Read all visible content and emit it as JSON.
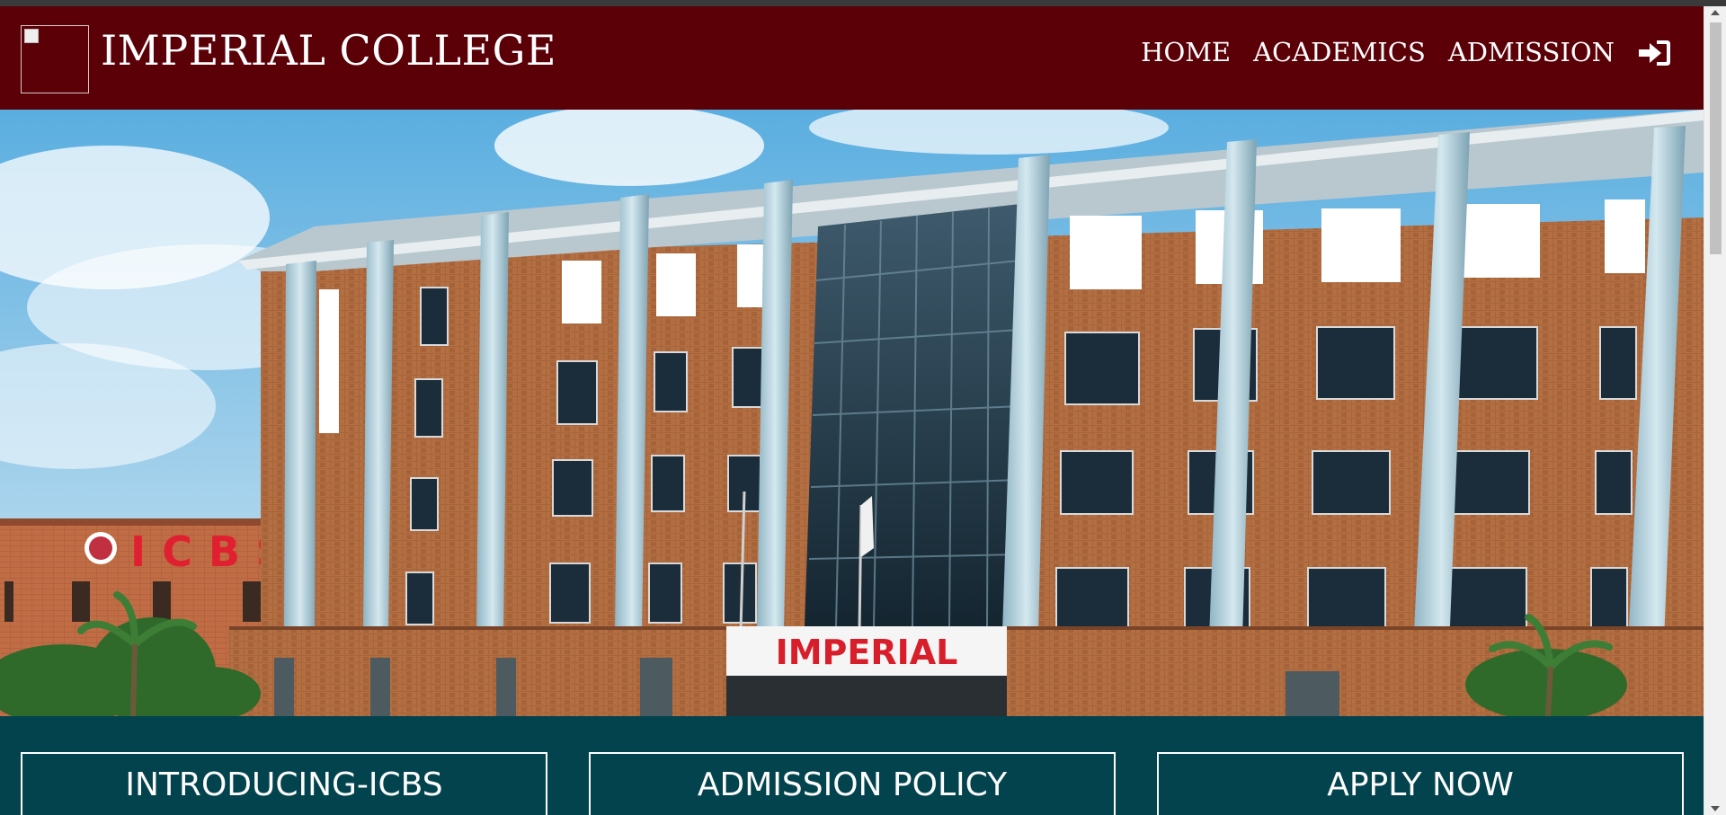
{
  "navbar": {
    "brand": "IMPERIAL COLLEGE",
    "links": [
      {
        "label": "HOME"
      },
      {
        "label": "ACADEMICS"
      },
      {
        "label": "ADMISSION"
      }
    ],
    "login_icon": "sign-in-icon"
  },
  "hero": {
    "main_sign": "IMPERIAL",
    "side_sign": "ICBS"
  },
  "band": {
    "buttons": [
      {
        "label": "INTRODUCING-ICBS"
      },
      {
        "label": "ADMISSION POLICY"
      },
      {
        "label": "APPLY NOW"
      }
    ]
  },
  "colors": {
    "navbar_bg": "#5c0008",
    "band_bg": "#02434e",
    "text": "#ffffff"
  }
}
